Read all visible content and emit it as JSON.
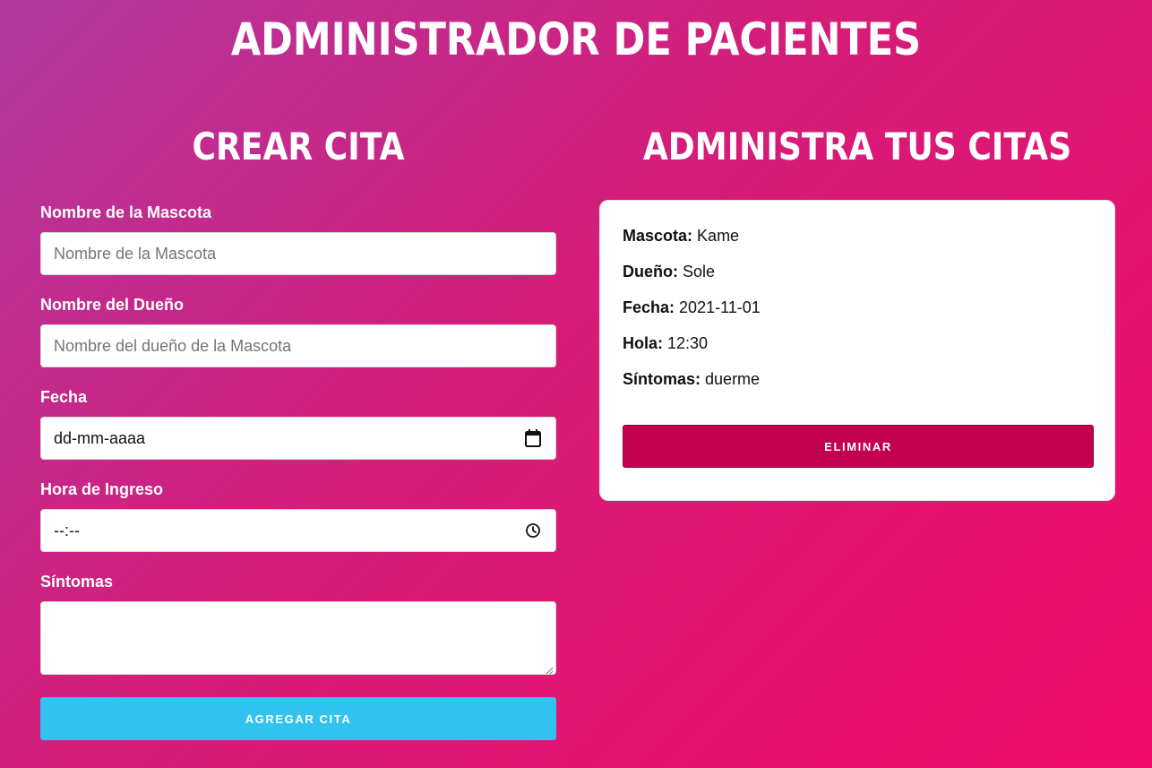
{
  "header": {
    "title": "ADMINISTRADOR DE PACIENTES"
  },
  "form": {
    "title": "CREAR CITA",
    "pet_label": "Nombre de la Mascota",
    "pet_placeholder": "Nombre de la Mascota",
    "owner_label": "Nombre del Dueño",
    "owner_placeholder": "Nombre del dueño de la Mascota",
    "date_label": "Fecha",
    "date_value": "dd-mm-aaaa",
    "time_label": "Hora de Ingreso",
    "time_value": "--:--",
    "symptoms_label": "Síntomas",
    "symptoms_value": "",
    "submit_label": "AGREGAR CITA"
  },
  "appointments": {
    "title": "ADMINISTRA TUS CITAS",
    "items": [
      {
        "pet_key": "Mascota:",
        "pet": "Kame",
        "owner_key": "Dueño:",
        "owner": "Sole",
        "date_key": "Fecha:",
        "date": "2021-11-01",
        "time_key": "Hola:",
        "time": "12:30",
        "symptoms_key": "Síntomas:",
        "symptoms": "duerme",
        "delete_label": "ELIMINAR"
      }
    ]
  },
  "icons": {
    "date": "calendar-icon",
    "time": "clock-icon"
  },
  "colors": {
    "gradient_start": "#b2389f",
    "gradient_end": "#f20b6b",
    "add_button": "#31c2ef",
    "delete_button": "#c2004f"
  }
}
